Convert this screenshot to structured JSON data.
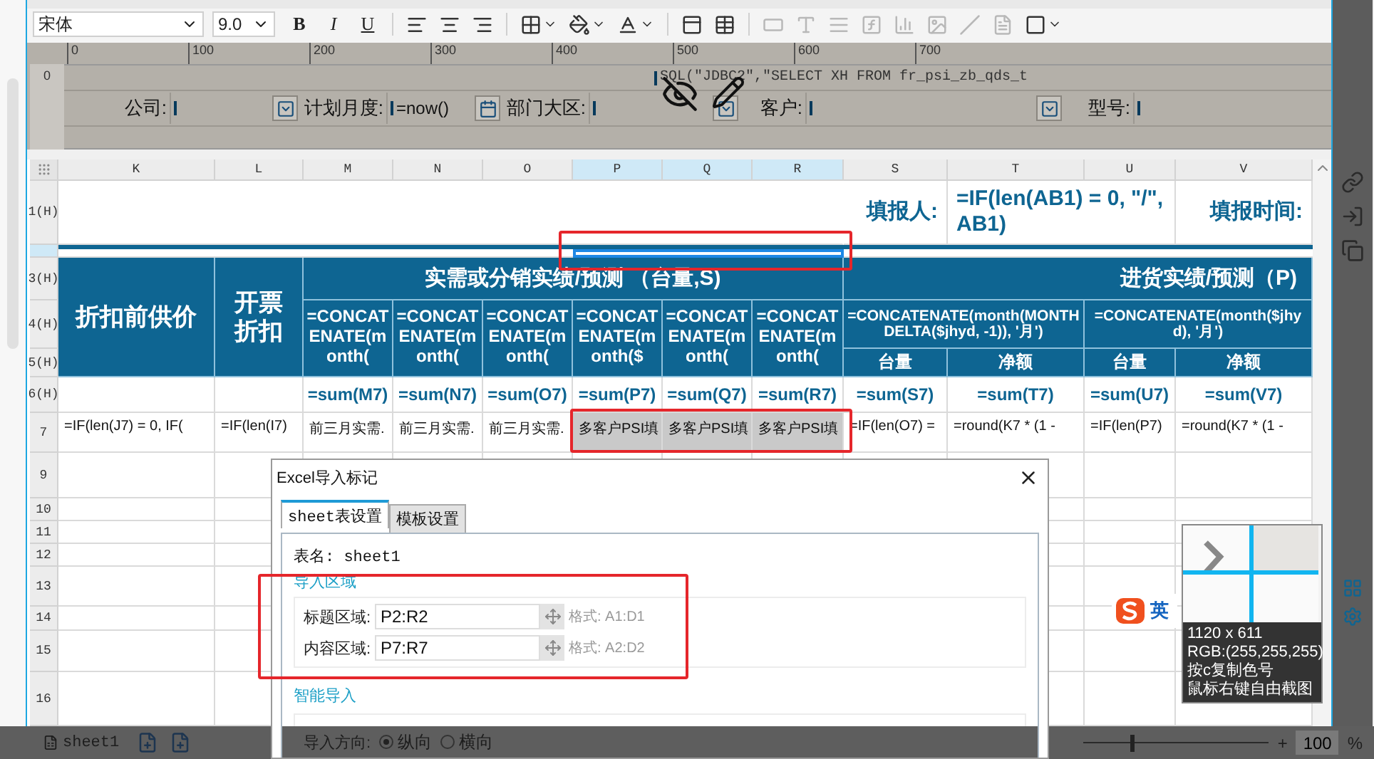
{
  "toolbar": {
    "font": "宋体",
    "size": "9.0",
    "style_buttons": [
      "B",
      "I",
      "U"
    ],
    "tools": [
      {
        "kind": "align-left",
        "disabled": false
      },
      {
        "kind": "align-center",
        "disabled": false
      },
      {
        "kind": "align-right",
        "disabled": false
      },
      {
        "kind": "border",
        "disabled": false
      },
      {
        "kind": "fill",
        "disabled": false
      },
      {
        "kind": "font-color",
        "disabled": false
      },
      {
        "kind": "cell-element",
        "disabled": false
      },
      {
        "kind": "table",
        "disabled": false
      },
      {
        "kind": "field",
        "disabled": true
      },
      {
        "kind": "text",
        "disabled": true
      },
      {
        "kind": "list",
        "disabled": true
      },
      {
        "kind": "formula",
        "disabled": true
      },
      {
        "kind": "chart",
        "disabled": true
      },
      {
        "kind": "image",
        "disabled": true
      },
      {
        "kind": "slash",
        "disabled": true
      },
      {
        "kind": "document",
        "disabled": true
      },
      {
        "kind": "frame",
        "disabled": false
      }
    ]
  },
  "ruler": {
    "ticks": [
      "0",
      "100",
      "200",
      "300",
      "400",
      "500",
      "600",
      "700"
    ],
    "vertical_tick": "0"
  },
  "parameters": {
    "sql": "SQL(\"JDBC2\",\"SELECT XH FROM fr_psi_zb_qds_t",
    "fields": [
      {
        "label": "公司:",
        "kind": "dropdown"
      },
      {
        "label": "计划月度:",
        "value": "=now()",
        "kind": "calendar"
      },
      {
        "label": "部门大区:",
        "kind": "dropdown"
      },
      {
        "label": "客户:",
        "kind": "dropdown"
      },
      {
        "label": "型号:",
        "kind": "plain"
      }
    ]
  },
  "sheet": {
    "columns": [
      {
        "label": "K",
        "selected": false
      },
      {
        "label": "L",
        "selected": false
      },
      {
        "label": "M",
        "selected": false
      },
      {
        "label": "N",
        "selected": false
      },
      {
        "label": "O",
        "selected": false
      },
      {
        "label": "P",
        "selected": true
      },
      {
        "label": "Q",
        "selected": true
      },
      {
        "label": "R",
        "selected": true
      },
      {
        "label": "S",
        "selected": false
      },
      {
        "label": "T",
        "selected": false
      },
      {
        "label": "U",
        "selected": false
      },
      {
        "label": "V",
        "selected": false
      }
    ],
    "row_headers": [
      {
        "label": "1(H)",
        "selected": false
      },
      {
        "selected": true
      },
      {
        "label": "3(H)",
        "selected": false
      },
      {
        "label": "4(H)",
        "selected": false
      },
      {
        "label": "5(H)",
        "selected": false
      },
      {
        "label": "6(H)",
        "selected": false
      },
      {
        "label": "7",
        "selected": false
      },
      {
        "label": "9",
        "selected": false
      },
      {
        "label": "10",
        "selected": false
      },
      {
        "label": "11",
        "selected": false
      },
      {
        "label": "12",
        "selected": false
      },
      {
        "label": "13",
        "selected": false
      },
      {
        "label": "14",
        "selected": false
      },
      {
        "label": "15",
        "selected": false
      },
      {
        "label": "16",
        "selected": false
      }
    ],
    "title_row": {
      "reporter_label": "填报人:",
      "reporter_formula": "=IF(len(AB1) = 0, \"/\", AB1)",
      "time_label": "填报时间:"
    },
    "header": {
      "price": "折扣前供价",
      "discount": "开票折扣",
      "group_1": "实需或分销实绩/预测 （台量,S)",
      "group_2": "进货实绩/预测（P)",
      "month_formulas": [
        "=CONCATENATE(month(",
        "=CONCATENATE(month(",
        "=CONCATENATE(month(",
        "=CONCATENATE(month($",
        "=CONCATENATE(month(",
        "=CONCATENATE(month("
      ],
      "month_groups": [
        "=CONCATENATE(month(MONTHDELTA($jhyd, -1)), '月')",
        "=CONCATENATE(month($jhyd), '月')"
      ],
      "sub_labels": [
        "台量",
        "净额",
        "台量",
        "净额"
      ]
    },
    "sum_row": [
      "=sum(M7)",
      "=sum(N7)",
      "=sum(O7)",
      "=sum(P7)",
      "=sum(Q7)",
      "=sum(R7)",
      "=sum(S7)",
      "=sum(T7)",
      "=sum(U7)",
      "=sum(V7)"
    ],
    "data_row": [
      {
        "text": "=IF(len(J7) = 0, IF(",
        "shaded": false
      },
      {
        "text": "=IF(len(I7)",
        "shaded": false
      },
      {
        "text": "前三月实需.",
        "shaded": false
      },
      {
        "text": "前三月实需.",
        "shaded": false
      },
      {
        "text": "前三月实需.",
        "shaded": false
      },
      {
        "text": "多客户PSI填",
        "shaded": true
      },
      {
        "text": "多客户PSI填",
        "shaded": true
      },
      {
        "text": "多客户PSI填",
        "shaded": true
      },
      {
        "text": "=IF(len(O7) =",
        "shaded": false
      },
      {
        "text": "=round(K7 * (1 -",
        "shaded": false
      },
      {
        "text": "=IF(len(P7)",
        "shaded": false
      },
      {
        "text": "=round(K7 * (1 -",
        "shaded": false
      }
    ]
  },
  "dialog": {
    "title": "Excel导入标记",
    "tabs": [
      {
        "label": "sheet表设置",
        "selected": true
      },
      {
        "label": "模板设置",
        "selected": false
      }
    ],
    "sheet_name": "表名: sheet1",
    "section_1": "导入区域",
    "ranges": [
      {
        "label": "标题区域:",
        "value": "P2:R2",
        "hint": "格式: A1:D1"
      },
      {
        "label": "内容区域:",
        "value": "P7:R7",
        "hint": "格式: A2:D2"
      }
    ],
    "section_2": "智能导入",
    "direction": {
      "label": "导入方向:",
      "options": [
        {
          "label": "纵向",
          "selected": true
        },
        {
          "label": "横向",
          "selected": false
        }
      ]
    }
  },
  "color_picker": {
    "size": "1120 x 611",
    "rgb": "RGB:(255,255,255)",
    "copy_hint": "按c复制色号",
    "capture_hint": "鼠标右键自由截图"
  },
  "ime": {
    "mode": "英"
  },
  "bottom_bar": {
    "sheet": "sheet1",
    "zoom": {
      "level": 0.25,
      "plus": "+",
      "value": "100",
      "unit": "%"
    }
  }
}
